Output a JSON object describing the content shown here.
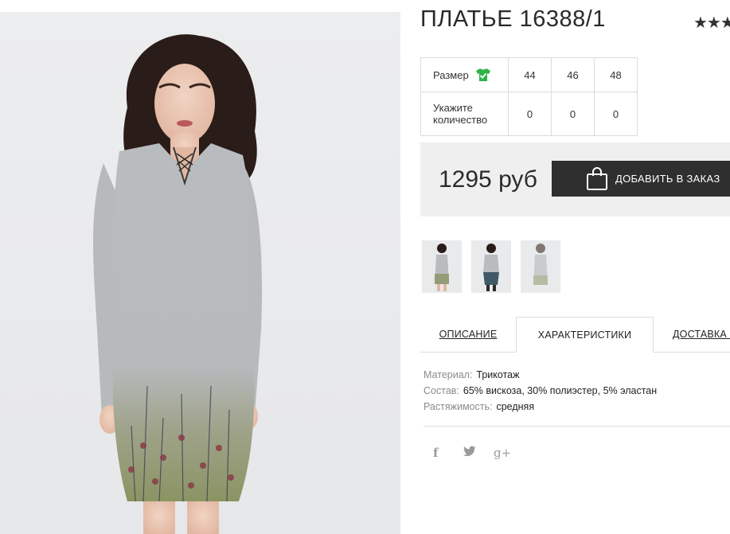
{
  "product": {
    "title": "ПЛАТЬЕ 16388/1",
    "rating_stars": "★★★"
  },
  "sizes": {
    "size_label": "Размер",
    "size_icon": "tshirt-check-icon",
    "quantity_label": "Укажите количество",
    "columns": [
      "44",
      "46",
      "48"
    ],
    "quantities": [
      "0",
      "0",
      "0"
    ]
  },
  "purchase": {
    "price": "1295 руб",
    "add_button": "ДОБАВИТЬ В ЗАКАЗ",
    "button_icon": "shopping-bag-icon"
  },
  "tabs": [
    {
      "label": "ОПИСАНИЕ",
      "active": false
    },
    {
      "label": "ХАРАКТЕРИСТИКИ",
      "active": true
    },
    {
      "label": "ДОСТАВКА И",
      "active": false
    }
  ],
  "specs": [
    {
      "key": "Материал:",
      "value": "Трикотаж"
    },
    {
      "key": "Состав:",
      "value": "65% вискоза, 30% полиэстер, 5% эластан"
    },
    {
      "key": "Растяжимость:",
      "value": "средняя"
    }
  ],
  "social": {
    "facebook": "f",
    "twitter": "twitter-icon",
    "googleplus": "g+"
  },
  "colors": {
    "button_bg": "#2f2f2f",
    "price_box_bg": "#efefef",
    "size_icon_green": "#2fb34a"
  }
}
